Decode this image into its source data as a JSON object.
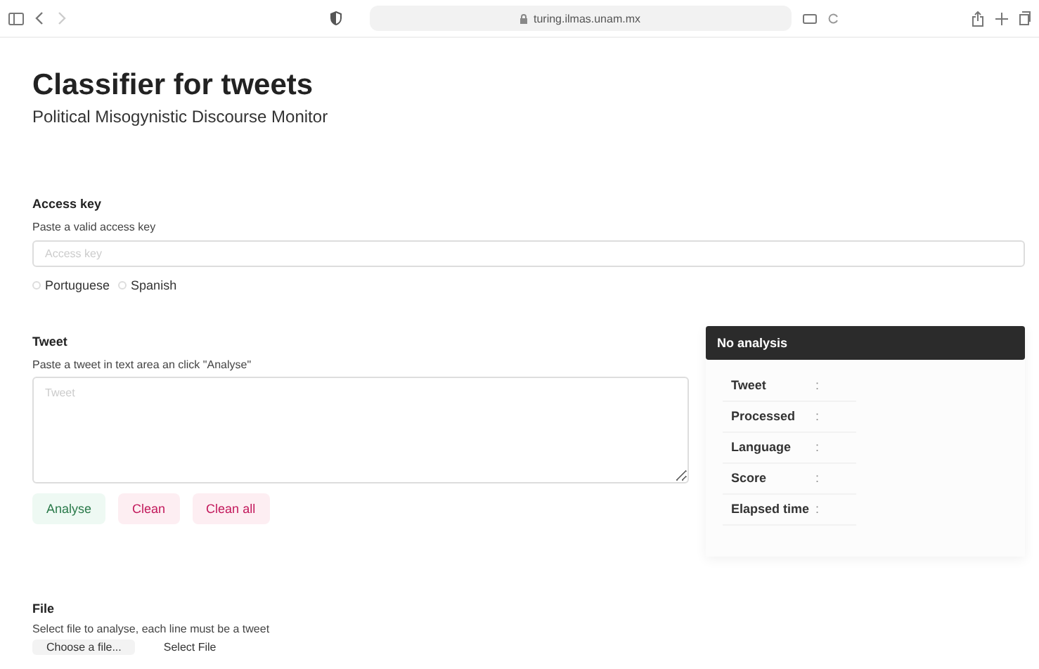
{
  "browser": {
    "url": "turing.ilmas.unam.mx",
    "back_disabled": false,
    "forward_disabled": true
  },
  "header": {
    "title": "Classifier for tweets",
    "subtitle": "Political Misogynistic Discourse Monitor"
  },
  "access_key": {
    "heading": "Access key",
    "hint": "Paste a valid access key",
    "placeholder": "Access key",
    "languages": [
      {
        "label": "Portuguese",
        "checked": false
      },
      {
        "label": "Spanish",
        "checked": false
      }
    ]
  },
  "tweet": {
    "heading": "Tweet",
    "hint": "Paste a tweet in text area an click \"Analyse\"",
    "placeholder": "Tweet",
    "buttons": [
      {
        "label": "Analyse",
        "kind": "primary"
      },
      {
        "label": "Clean",
        "kind": "danger"
      },
      {
        "label": "Clean all",
        "kind": "danger"
      }
    ]
  },
  "analysis": {
    "title": "No analysis",
    "rows": [
      {
        "label": "Tweet",
        "separator": ":"
      },
      {
        "label": "Processed",
        "separator": ":"
      },
      {
        "label": "Language",
        "separator": ":"
      },
      {
        "label": "Score",
        "separator": ":"
      },
      {
        "label": "Elapsed time",
        "separator": ":"
      }
    ]
  },
  "file": {
    "heading": "File",
    "hint": "Select file to analyse, each line must be a tweet",
    "choose_label": "Choose a file...",
    "select_label": "Select File"
  }
}
